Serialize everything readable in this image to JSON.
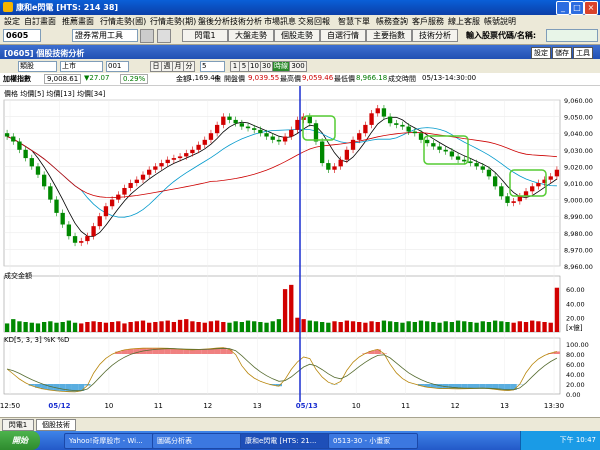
{
  "window": {
    "title": "康和e閃電 [HTS: 214 38]"
  },
  "menu": [
    "設定",
    "自訂畫面",
    "推薦畫面",
    "行情走勢(國)",
    "行情走勢(期)",
    "盤後分析",
    "技術分析",
    "市場訊息",
    "交易回報",
    "智慧下單",
    "帳務查詢",
    "客戶服務",
    "線上客服",
    "帳號說明"
  ],
  "toolbar": {
    "code": "0605",
    "tool_select": "證券常用工具",
    "buttons": [
      "閃電1",
      "大盤走勢",
      "個股走勢",
      "自選行情",
      "主要指數",
      "技術分析"
    ],
    "search_label": "輸入股票代碼/名稱:"
  },
  "subwindow": {
    "title": "[0605] 個股技術分析",
    "buttons": [
      "設定",
      "儲存",
      "工具"
    ]
  },
  "controls": {
    "category": "類股",
    "market": "上市",
    "code": "001",
    "periods": [
      "日",
      "週",
      "月",
      "分"
    ],
    "minute": "5",
    "intervals": [
      "1",
      "5",
      "10",
      "30"
    ],
    "mode": "時線",
    "count": "300"
  },
  "info": {
    "name": "加權指數",
    "price": "9,008.61",
    "change": "▼27.07",
    "change_pct": "0.29%",
    "amount_label": "金額",
    "amount": "1,169.44",
    "amount_unit": "億",
    "open_label": "開盤價",
    "open": "9,039.55",
    "high_label": "最高價",
    "high": "9,059.46",
    "low_label": "最低價",
    "low": "8,966.18",
    "time_label": "成交時間",
    "time": "05/13-14:30:00"
  },
  "panels": {
    "price_label": "價格 均價[5] 均價[13] 均價[34]",
    "volume_label": "成交金額",
    "volume_unit": "[x億]",
    "kd_label": "KD[5, 3, 3] %K %D"
  },
  "chart_data": {
    "type": "candlestick",
    "price_axis": {
      "ticks": [
        "9,060.00",
        "9,050.00",
        "9,040.00",
        "9,030.00",
        "9,020.00",
        "9,010.00",
        "9,000.00",
        "8,990.00",
        "8,980.00",
        "8,970.00",
        "8,960.00"
      ],
      "ylim": [
        8960,
        9060
      ]
    },
    "volume_axis": {
      "ticks": [
        "60.00",
        "40.00",
        "20.00"
      ],
      "ylim": [
        0,
        70
      ]
    },
    "kd_axis": {
      "ticks": [
        "100.00",
        "80.00",
        "60.00",
        "40.00",
        "20.00",
        "0.00"
      ],
      "ylim": [
        0,
        100
      ]
    },
    "x_labels": [
      "12:50",
      "05/12",
      "10",
      "11",
      "12",
      "13",
      "05/13",
      "10",
      "11",
      "12",
      "13",
      "13:30"
    ],
    "series": [
      {
        "name": "均價[5]",
        "color": "#000000"
      },
      {
        "name": "均價[13]",
        "color": "#0099cc"
      },
      {
        "name": "均價[34]",
        "color": "#cc0000"
      }
    ],
    "close": [
      9038,
      9035,
      9030,
      9025,
      9020,
      9015,
      9008,
      9000,
      8992,
      8985,
      8978,
      8974,
      8975,
      8978,
      8984,
      8990,
      8996,
      9000,
      9003,
      9007,
      9010,
      9012,
      9015,
      9018,
      9020,
      9022,
      9024,
      9025,
      9026,
      9028,
      9030,
      9033,
      9036,
      9040,
      9045,
      9050,
      9048,
      9046,
      9044,
      9043,
      9042,
      9040,
      9038,
      9036,
      9035,
      9038,
      9042,
      9048,
      9050,
      9046,
      9035,
      9022,
      9018,
      9020,
      9024,
      9030,
      9036,
      9040,
      9045,
      9052,
      9055,
      9050,
      9046,
      9045,
      9044,
      9041,
      9040,
      9036,
      9034,
      9032,
      9030,
      9029,
      9026,
      9024,
      9023,
      9022,
      9020,
      9018,
      9014,
      9008,
      9002,
      8998,
      8999,
      9002,
      9005,
      9008,
      9010,
      9012,
      9014,
      9018
    ],
    "volume": [
      12,
      18,
      15,
      14,
      13,
      12,
      14,
      15,
      13,
      14,
      16,
      13,
      12,
      14,
      15,
      14,
      13,
      14,
      15,
      12,
      14,
      15,
      16,
      13,
      14,
      15,
      16,
      14,
      17,
      18,
      15,
      14,
      13,
      15,
      16,
      14,
      13,
      15,
      14,
      16,
      15,
      14,
      13,
      15,
      18,
      60,
      66,
      20,
      18,
      16,
      15,
      14,
      13,
      15,
      14,
      16,
      15,
      14,
      13,
      15,
      14,
      16,
      15,
      14,
      13,
      15,
      14,
      16,
      15,
      14,
      13,
      15,
      14,
      16,
      15,
      14,
      13,
      15,
      14,
      16,
      15,
      14,
      13,
      15,
      14,
      16,
      15,
      14,
      13,
      62
    ]
  },
  "tabs": [
    "閃電1",
    "個股技術"
  ],
  "taskbar": {
    "start": "開始",
    "tasks": [
      "Yahoo!奇摩股市 - Wi...",
      "圖碼分析表",
      "康和e閃電 [HTS: 21...",
      "0513-30 - 小畫家"
    ],
    "clock": "下午 10:47"
  }
}
